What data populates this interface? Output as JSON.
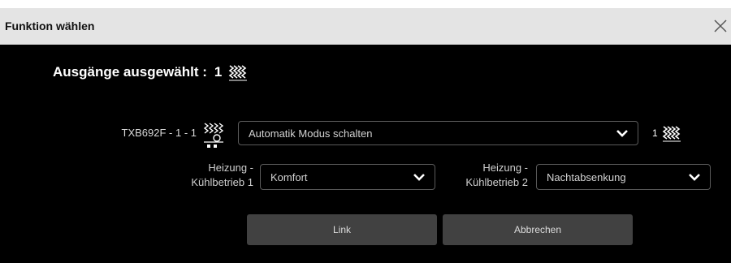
{
  "dialog": {
    "title": "Funktion wählen",
    "close_icon": "close-icon"
  },
  "header": {
    "label": "Ausgänge ausgewählt :",
    "count": "1",
    "icon": "heating-wave-icon"
  },
  "device": {
    "label": "TXB692F - 1 - 1",
    "icon": "heating-sensor-icon",
    "function_value": "Automatik Modus schalten",
    "output_count": "1",
    "output_icon": "heating-wave-icon"
  },
  "options": {
    "label1_line1": "Heizung -",
    "label1_line2": "Kühlbetrieb 1",
    "value1": "Komfort",
    "label2_line1": "Heizung -",
    "label2_line2": "Kühlbetrieb 2",
    "value2": "Nachtabsenkung"
  },
  "buttons": {
    "link": "Link",
    "cancel": "Abbrechen"
  },
  "colors": {
    "background": "#000000",
    "titlebar": "#e4e4e4",
    "button": "#414141"
  }
}
